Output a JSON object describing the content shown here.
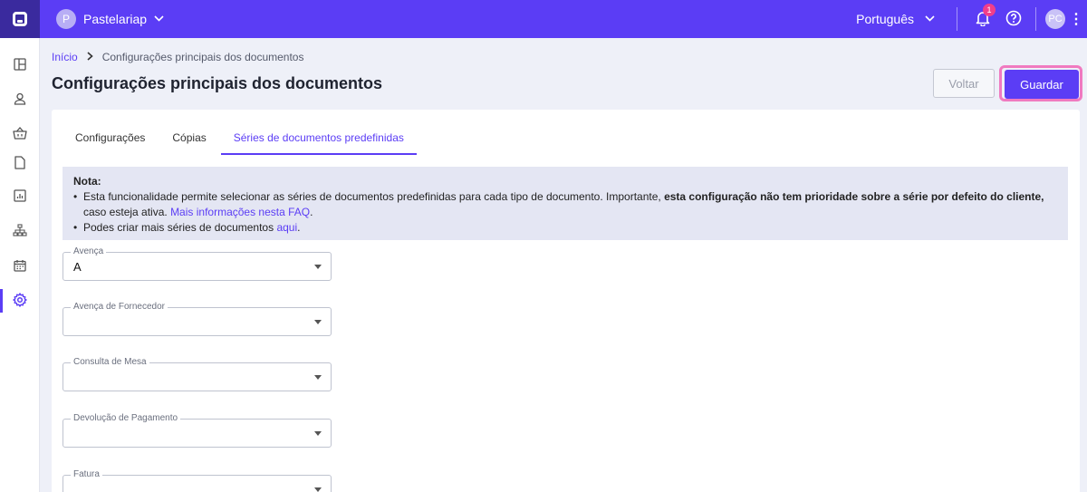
{
  "topbar": {
    "company_initial": "P",
    "company_name": "Pastelariap",
    "language": "Português",
    "notification_count": "1",
    "user_initials": "PC"
  },
  "sidebar": {
    "items": [
      {
        "name": "dashboard-icon"
      },
      {
        "name": "user-icon"
      },
      {
        "name": "basket-icon"
      },
      {
        "name": "document-icon"
      },
      {
        "name": "chart-icon"
      },
      {
        "name": "hierarchy-icon"
      },
      {
        "name": "calendar-icon"
      },
      {
        "name": "gear-icon",
        "active": true
      }
    ]
  },
  "breadcrumb": {
    "home": "Início",
    "current": "Configurações principais dos documentos"
  },
  "page": {
    "title": "Configurações principais dos documentos",
    "back_label": "Voltar",
    "save_label": "Guardar"
  },
  "tabs": [
    {
      "label": "Configurações"
    },
    {
      "label": "Cópias"
    },
    {
      "label": "Séries de documentos predefinidas",
      "active": true
    }
  ],
  "note": {
    "title": "Nota:",
    "line1_pre": "Esta funcionalidade permite selecionar as séries de documentos predefinidas para cada tipo de documento. Importante, ",
    "line1_bold": "esta configuração não tem prioridade sobre a série por defeito do cliente,",
    "line1_post": " caso esteja ativa. ",
    "line1_link": "Mais informações nesta FAQ",
    "line1_end": ".",
    "line2_pre": "Podes criar mais séries de documentos ",
    "line2_link": "aqui",
    "line2_end": "."
  },
  "fields": [
    {
      "label": "Avença",
      "value": "A"
    },
    {
      "label": "Avença de Fornecedor",
      "value": ""
    },
    {
      "label": "Consulta de Mesa",
      "value": ""
    },
    {
      "label": "Devolução de Pagamento",
      "value": ""
    },
    {
      "label": "Fatura",
      "value": ""
    }
  ],
  "colors": {
    "brand": "#5b3df5",
    "highlight": "#f07ac0",
    "badge": "#f03e8b"
  }
}
